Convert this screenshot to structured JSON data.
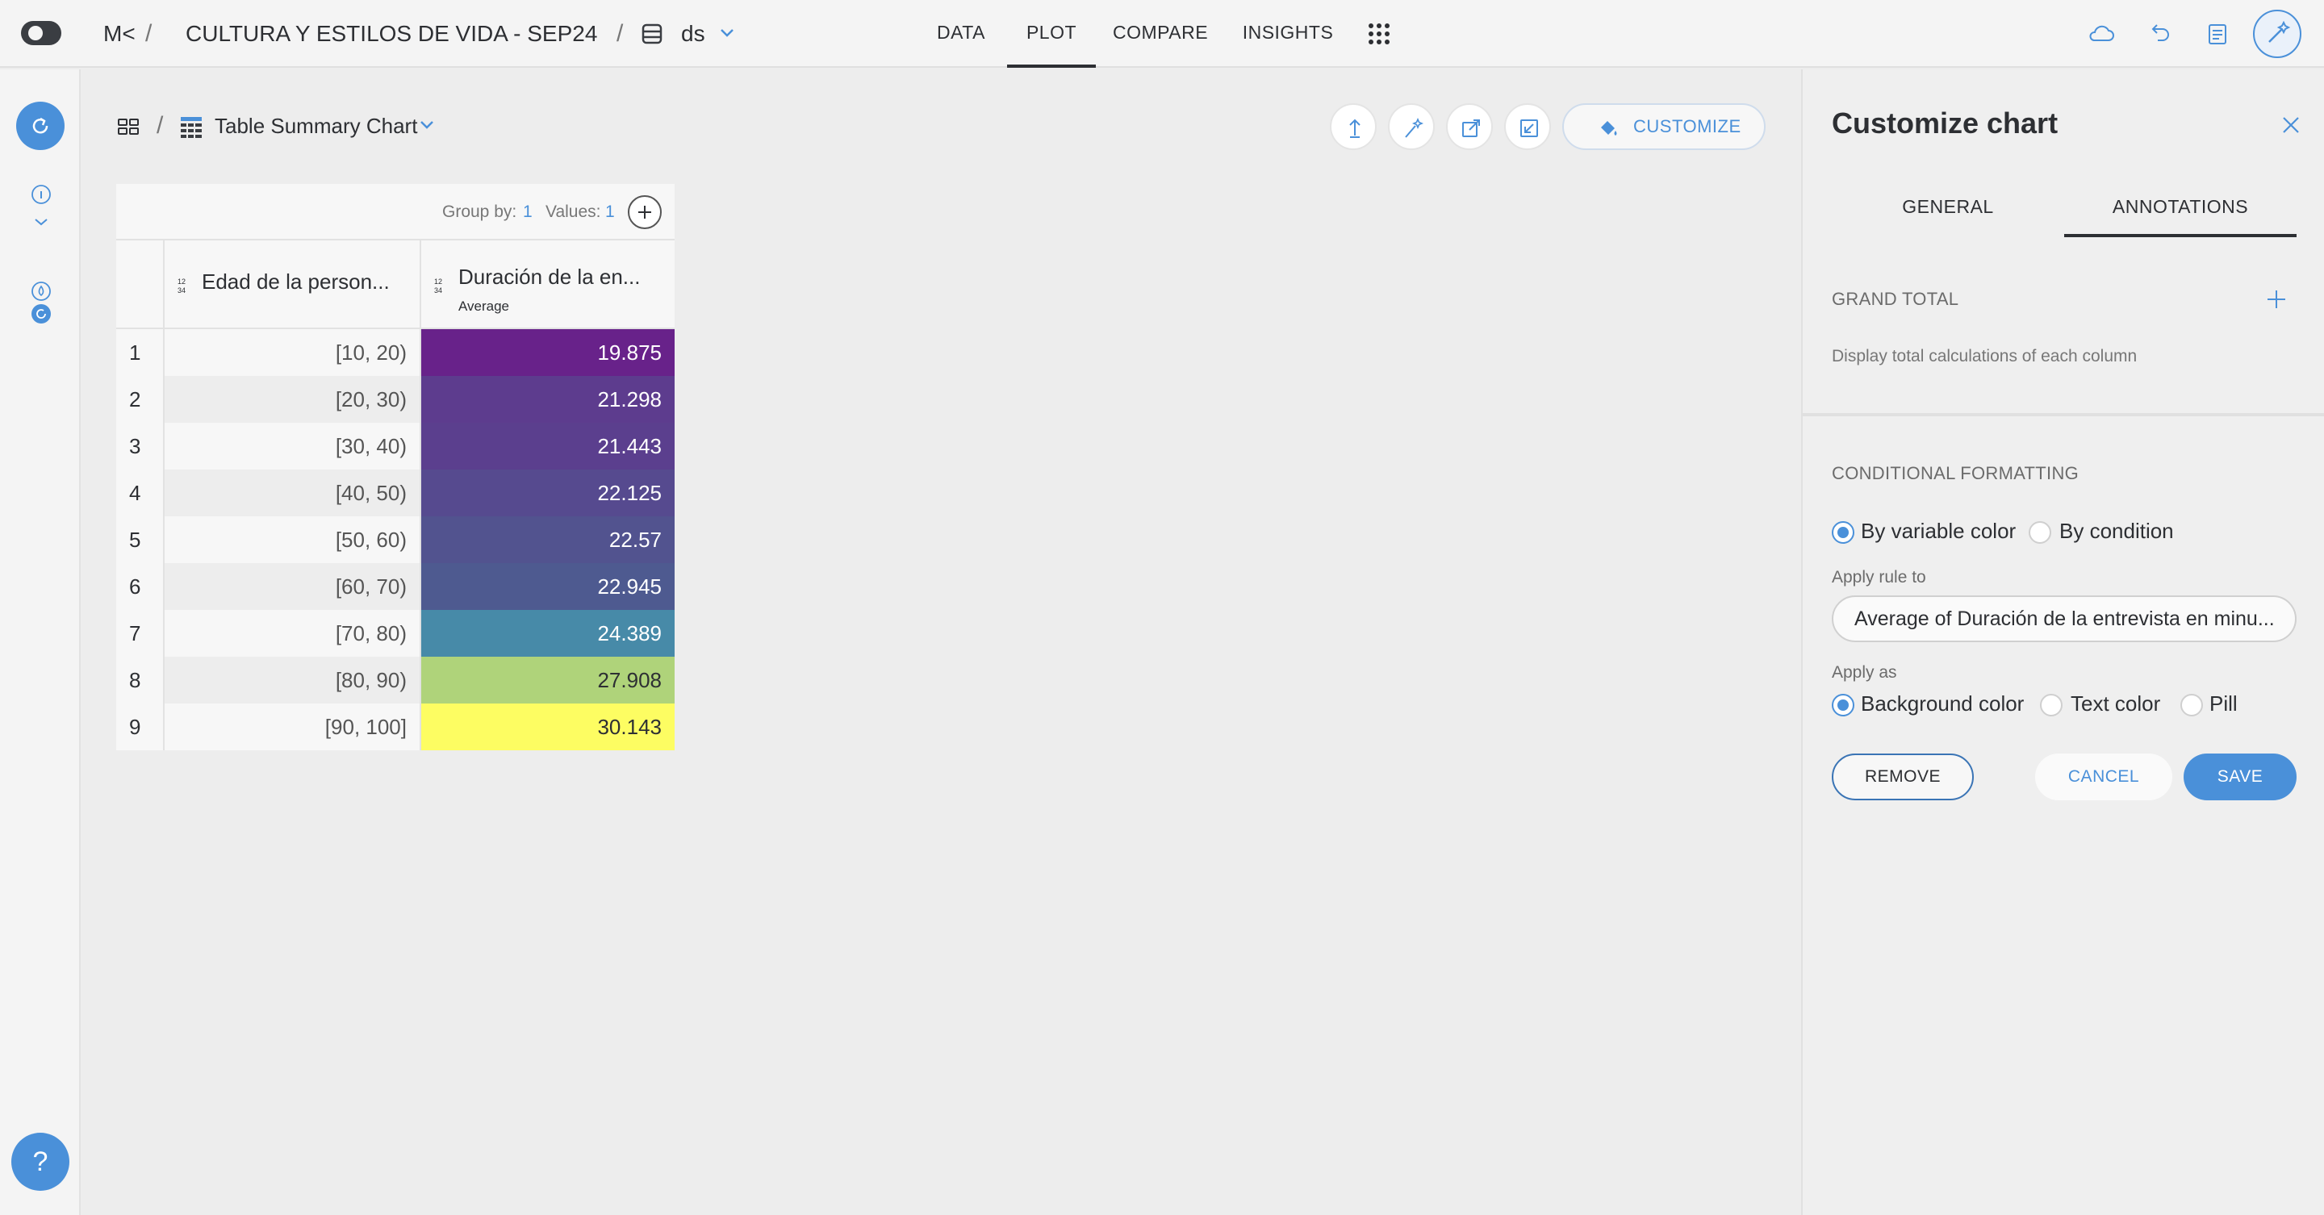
{
  "header": {
    "logo_text": "M<",
    "project_title": "CULTURA Y ESTILOS DE VIDA - SEP24",
    "dataset_name": "ds",
    "separator": "/",
    "nav_tabs": [
      {
        "label": "DATA"
      },
      {
        "label": "PLOT"
      },
      {
        "label": "COMPARE"
      },
      {
        "label": "INSIGHTS"
      }
    ],
    "active_tab": "PLOT",
    "icons": [
      "cloud-icon",
      "undo-icon",
      "report-icon",
      "magic-wand-icon"
    ]
  },
  "sidebar": {
    "help_label": "?",
    "icons": [
      "refresh-icon",
      "info-icon",
      "chevron-down-icon",
      "drop-icon",
      "small-refresh-icon"
    ]
  },
  "chart": {
    "title": "Table Summary Chart",
    "customize_label": "CUSTOMIZE",
    "toolbar_icons": [
      "upload-icon",
      "sparkle-icon",
      "external-link-icon",
      "resize-icon"
    ],
    "group_by_label": "Group by:",
    "group_by_count": "1",
    "values_label": "Values:",
    "values_count": "1",
    "columns": [
      {
        "label": "Edad de la person...",
        "sub": ""
      },
      {
        "label": "Duración de la en...",
        "sub": "Average"
      }
    ]
  },
  "chart_data": {
    "type": "table",
    "columns": [
      "Edad de la person...",
      "Duración de la en... (Average)"
    ],
    "rows": [
      {
        "index": "1",
        "range": "[10, 20)",
        "value": "19.875",
        "bg": "#68228a",
        "fg": "#ffffff"
      },
      {
        "index": "2",
        "range": "[20, 30)",
        "value": "21.298",
        "bg": "#5d3c8e",
        "fg": "#ffffff"
      },
      {
        "index": "3",
        "range": "[30, 40)",
        "value": "21.443",
        "bg": "#5b3f8e",
        "fg": "#ffffff"
      },
      {
        "index": "4",
        "range": "[40, 50)",
        "value": "22.125",
        "bg": "#564a8f",
        "fg": "#ffffff"
      },
      {
        "index": "5",
        "range": "[50, 60)",
        "value": "22.57",
        "bg": "#52538f",
        "fg": "#ffffff"
      },
      {
        "index": "6",
        "range": "[60, 70)",
        "value": "22.945",
        "bg": "#4e5a90",
        "fg": "#ffffff"
      },
      {
        "index": "7",
        "range": "[70, 80)",
        "value": "24.389",
        "bg": "#478aa8",
        "fg": "#ffffff"
      },
      {
        "index": "8",
        "range": "[80, 90)",
        "value": "27.908",
        "bg": "#afd37a",
        "fg": "#2d2f33"
      },
      {
        "index": "9",
        "range": "[90, 100]",
        "value": "30.143",
        "bg": "#fdfd62",
        "fg": "#2d2f33"
      }
    ]
  },
  "panel": {
    "title": "Customize chart",
    "tabs": [
      {
        "label": "GENERAL"
      },
      {
        "label": "ANNOTATIONS"
      }
    ],
    "active_tab": "ANNOTATIONS",
    "grand_total_label": "GRAND TOTAL",
    "grand_total_desc": "Display total calculations of each column",
    "conditional_label": "CONDITIONAL FORMATTING",
    "mode_options": [
      {
        "label": "By variable color",
        "selected": true
      },
      {
        "label": "By condition",
        "selected": false
      }
    ],
    "apply_rule_label": "Apply rule to",
    "apply_rule_value": "Average of Duración de la entrevista en minu...",
    "apply_as_label": "Apply as",
    "apply_as_options": [
      {
        "label": "Background color",
        "selected": true
      },
      {
        "label": "Text color",
        "selected": false
      },
      {
        "label": "Pill",
        "selected": false
      }
    ],
    "remove_label": "REMOVE",
    "cancel_label": "CANCEL",
    "save_label": "SAVE"
  },
  "colors": {
    "accent": "#4a90d9",
    "text": "#2d2f33",
    "background": "#ededed"
  }
}
